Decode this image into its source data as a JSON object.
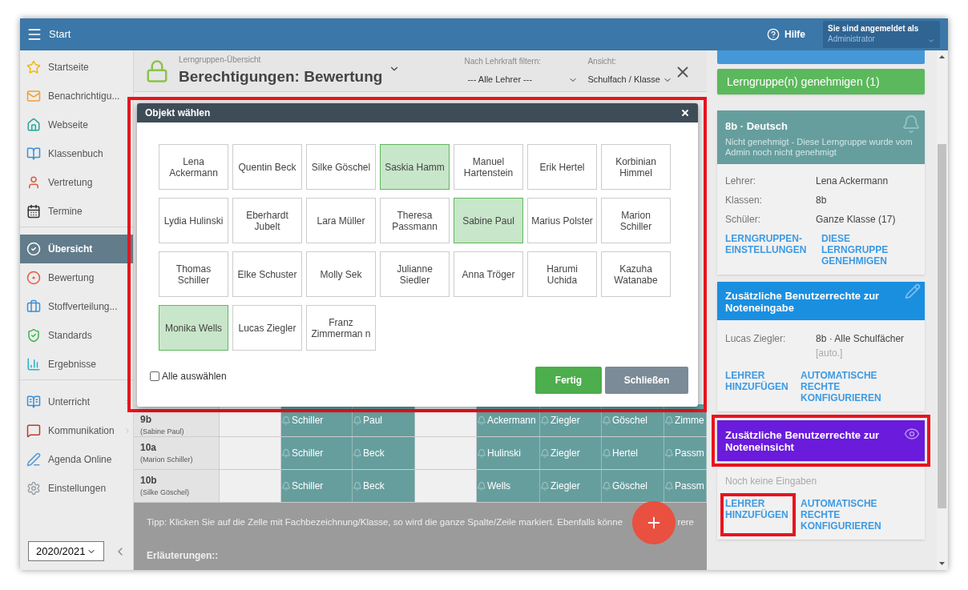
{
  "topbar": {
    "title": "Start",
    "help": "Hilfe",
    "user_label": "Sie sind angemeldet als",
    "user_role": "Administrator"
  },
  "sidebar": {
    "groups": [
      [
        {
          "label": "Startseite",
          "selected": false
        },
        {
          "label": "Benachrichtigu...",
          "selected": false
        },
        {
          "label": "Webseite",
          "selected": false
        },
        {
          "label": "Klassenbuch",
          "selected": false
        },
        {
          "label": "Vertretung",
          "selected": false
        },
        {
          "label": "Termine",
          "selected": false
        }
      ],
      [
        {
          "label": "Übersicht",
          "selected": true
        },
        {
          "label": "Bewertung",
          "selected": false
        },
        {
          "label": "Stoffverteilung...",
          "selected": false
        },
        {
          "label": "Standards",
          "selected": false
        },
        {
          "label": "Ergebnisse",
          "selected": false
        }
      ],
      [
        {
          "label": "Unterricht",
          "selected": false,
          "submenu": true
        },
        {
          "label": "Kommunikation",
          "selected": false,
          "submenu": true
        },
        {
          "label": "Agenda Online",
          "selected": false,
          "submenu": false
        },
        {
          "label": "Einstellungen",
          "selected": false,
          "submenu": false
        }
      ]
    ],
    "year": "2020/2021"
  },
  "page_header": {
    "breadcrumb": "Lerngruppen-Übersicht",
    "title": "Berechtigungen: Bewertung",
    "filter_label": "Nach Lehrkraft filtern:",
    "filter_value": "--- Alle Lehrer ---",
    "view_label": "Ansicht:",
    "view_value": "Schulfach / Klasse"
  },
  "table": {
    "rows": [
      {
        "class": "9b",
        "teacher": "(Sabine Paul)",
        "cells": [
          null,
          "Schiller",
          "Paul",
          null,
          "Ackermann",
          "Ziegler",
          "Göschel",
          "Zimme"
        ]
      },
      {
        "class": "10a",
        "teacher": "(Marion Schiller)",
        "cells": [
          null,
          "Schiller",
          "Beck",
          null,
          "Hulinski",
          "Ziegler",
          "Hertel",
          "Passm"
        ]
      },
      {
        "class": "10b",
        "teacher": "(Silke Göschel)",
        "cells": [
          null,
          "Schiller",
          "Beck",
          null,
          "Wells",
          "Ziegler",
          "Göschel",
          "Passm"
        ]
      }
    ]
  },
  "tip": {
    "text": "Tipp: Klicken Sie auf die Zelle mit Fachbezeichnung/Klasse, so wird die ganze Spalte/Zeile markiert. Ebenfalls könne",
    "text_after": "rere",
    "heading": "Erläuterungen::"
  },
  "modal": {
    "title": "Objekt wählen",
    "teachers": [
      {
        "name": "Lena Ackermann",
        "selected": false
      },
      {
        "name": "Quentin Beck",
        "selected": false
      },
      {
        "name": "Silke Göschel",
        "selected": false
      },
      {
        "name": "Saskia Hamm",
        "selected": true
      },
      {
        "name": "Manuel Hartenstein",
        "selected": false
      },
      {
        "name": "Erik Hertel",
        "selected": false
      },
      {
        "name": "Korbinian Himmel",
        "selected": false
      },
      {
        "name": "Lydia Hulinski",
        "selected": false
      },
      {
        "name": "Eberhardt Jubelt",
        "selected": false
      },
      {
        "name": "Lara Müller",
        "selected": false
      },
      {
        "name": "Theresa Passmann",
        "selected": false
      },
      {
        "name": "Sabine Paul",
        "selected": true
      },
      {
        "name": "Marius Polster",
        "selected": false
      },
      {
        "name": "Marion Schiller",
        "selected": false
      },
      {
        "name": "Thomas Schiller",
        "selected": false
      },
      {
        "name": "Elke Schuster",
        "selected": false
      },
      {
        "name": "Molly Sek",
        "selected": false
      },
      {
        "name": "Julianne Siedler",
        "selected": false
      },
      {
        "name": "Anna Tröger",
        "selected": false
      },
      {
        "name": "Harumi Uchida",
        "selected": false
      },
      {
        "name": "Kazuha Watanabe",
        "selected": false
      },
      {
        "name": "Monika Wells",
        "selected": true
      },
      {
        "name": "Lucas Ziegler",
        "selected": false
      },
      {
        "name": "Franz Zimmerman n",
        "selected": false
      }
    ],
    "select_all": {
      "label": "Alle auswählen",
      "checked": false
    },
    "done": "Fertig",
    "close": "Schließen"
  },
  "right_panel": {
    "approve_button": "Lerngruppe(n) genehmigen (1)",
    "group_card": {
      "title": "8b · Deutsch",
      "subtitle": "Nicht genehmigt - Diese Lerngruppe wurde vom Admin noch nicht genehmigt",
      "fields": [
        {
          "label": "Lehrer:",
          "value": "Lena Ackermann"
        },
        {
          "label": "Klassen:",
          "value": "8b"
        },
        {
          "label": "Schüler:",
          "value": "Ganze Klasse (17)"
        }
      ],
      "links": [
        "LERNGRUPPEN-EINSTELLUNGEN",
        "DIESE LERNGRUPPE GENEHMIGEN"
      ]
    },
    "entry_card": {
      "title": "Zusätzliche Benutzerrechte zur Noteneingabe",
      "entries": [
        {
          "label": "Lucas Ziegler:",
          "value": "8b · Alle Schulfächer",
          "note": "[auto.]"
        }
      ],
      "links": [
        "LEHRER HINZUFÜGEN",
        "AUTOMATISCHE RECHTE KONFIGURIEREN"
      ]
    },
    "view_card": {
      "title": "Zusätzliche Benutzerrechte zur Noteneinsicht",
      "empty": "Noch keine Eingaben",
      "links": [
        "LEHRER HINZUFÜGEN",
        "AUTOMATISCHE RECHTE KONFIGURIEREN"
      ]
    }
  }
}
